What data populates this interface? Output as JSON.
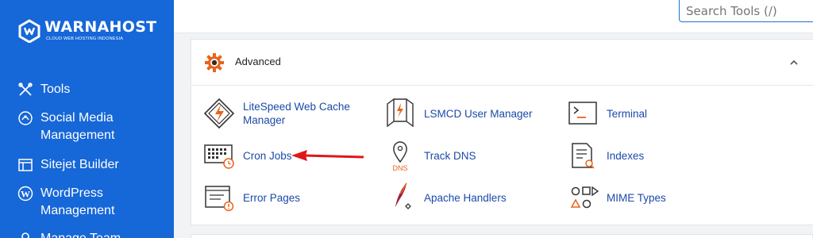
{
  "brand": {
    "name": "WARNAHOST",
    "tagline": "CLOUD WEB HOSTING INDONESIA"
  },
  "sidebar": {
    "items": [
      {
        "label": "Tools",
        "icon": "tools-icon"
      },
      {
        "label": "Social Media\nManagement",
        "icon": "social-media-icon"
      },
      {
        "label": "Sitejet Builder",
        "icon": "sitejet-icon"
      },
      {
        "label": "WordPress\nManagement",
        "icon": "wordpress-icon"
      },
      {
        "label": "Manage Team",
        "icon": "manage-team-icon"
      }
    ]
  },
  "search": {
    "placeholder": "Search Tools (/)"
  },
  "section": {
    "title": "Advanced",
    "tools": [
      {
        "label": "LiteSpeed Web Cache\nManager",
        "icon": "litespeed-icon"
      },
      {
        "label": "LSMCD User Manager",
        "icon": "lsmcd-icon"
      },
      {
        "label": "Terminal",
        "icon": "terminal-icon"
      },
      {
        "label": "Cron Jobs",
        "icon": "cron-jobs-icon"
      },
      {
        "label": "Track DNS",
        "icon": "track-dns-icon"
      },
      {
        "label": "Indexes",
        "icon": "indexes-icon"
      },
      {
        "label": "Error Pages",
        "icon": "error-pages-icon"
      },
      {
        "label": "Apache Handlers",
        "icon": "apache-handlers-icon"
      },
      {
        "label": "MIME Types",
        "icon": "mime-types-icon"
      }
    ]
  },
  "dns_badge": "DNS",
  "colors": {
    "sidebar": "#1667d8",
    "link": "#1b4aa8",
    "accent": "#e8641b",
    "annotation_arrow": "#e0161b"
  }
}
